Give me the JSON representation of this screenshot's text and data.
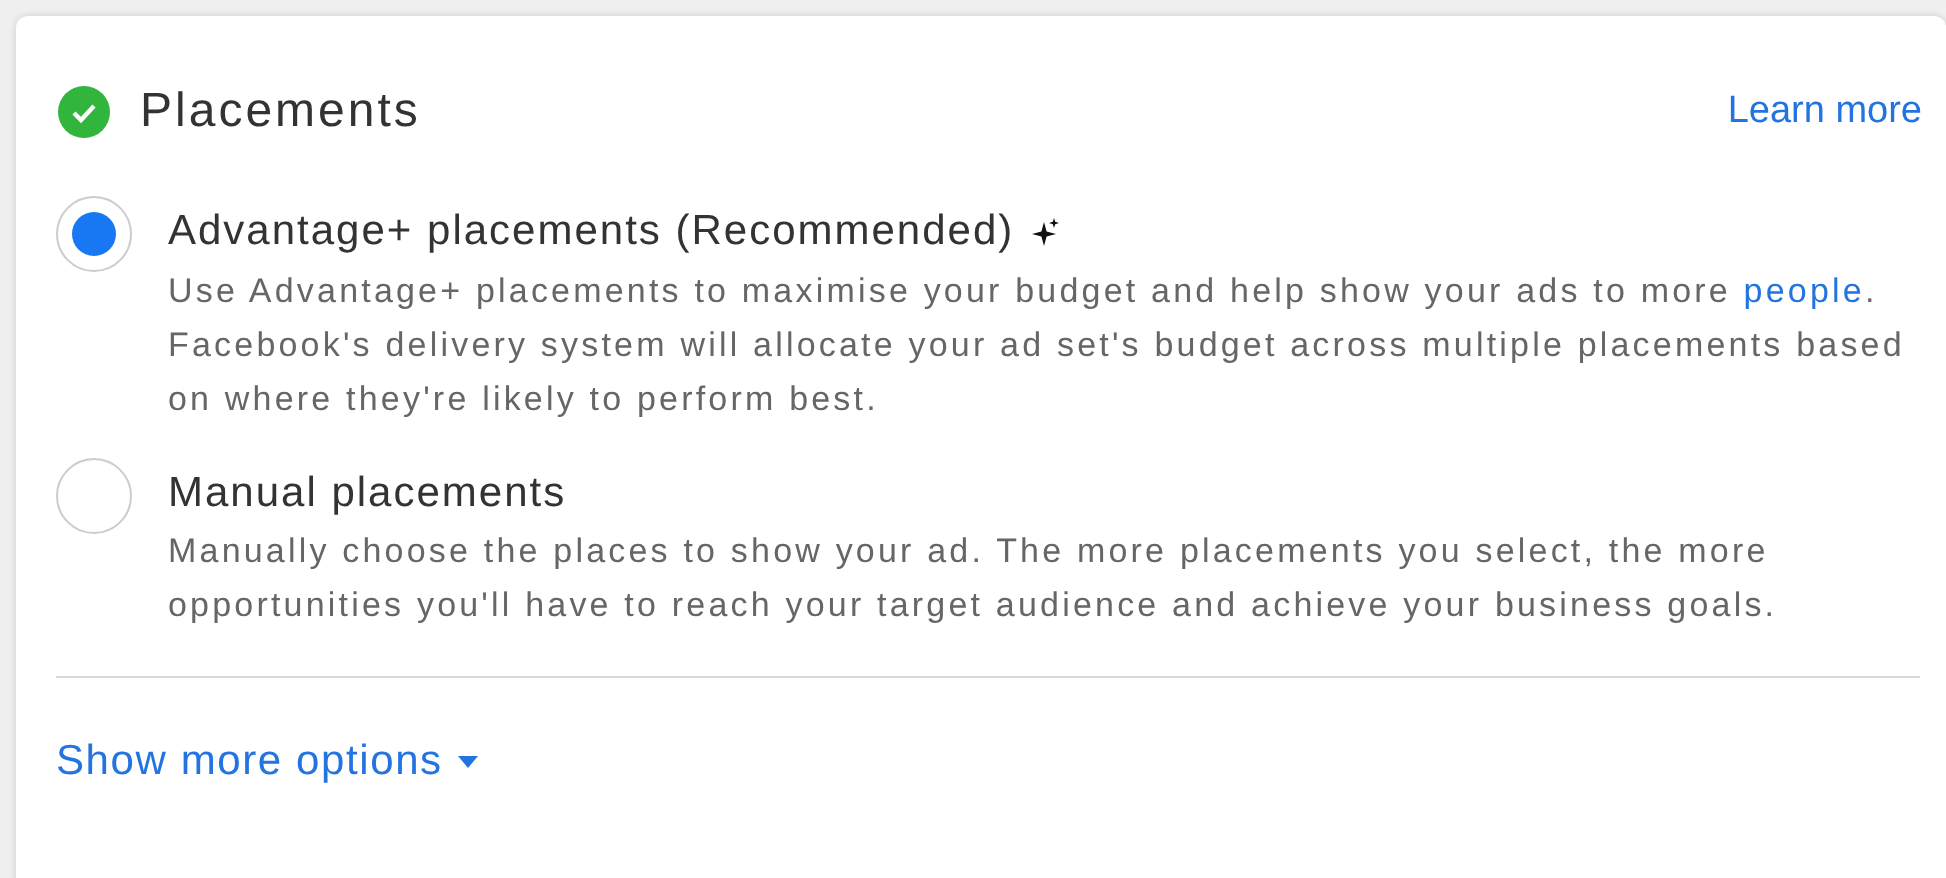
{
  "header": {
    "title": "Placements",
    "complete": true,
    "link": "Learn more"
  },
  "options": [
    {
      "label": "Advantage+ placements (Recommended)",
      "sparkle": true,
      "selected": true,
      "description": "Use Advantage+ placements to maximise your budget and help show your ads to more",
      "link": "people",
      "description_end": ". Facebook's delivery system will allocate your ad set's budget across multiple placements based on where they're likely to perform best."
    },
    {
      "label": "Manual placements",
      "sparkle": false,
      "selected": false,
      "description": "Manually choose the places to show your ad. The more placements you select, the more opportunities you'll have to reach your target audience and achieve your business goals."
    }
  ],
  "footer": {
    "link": "Show more options"
  }
}
